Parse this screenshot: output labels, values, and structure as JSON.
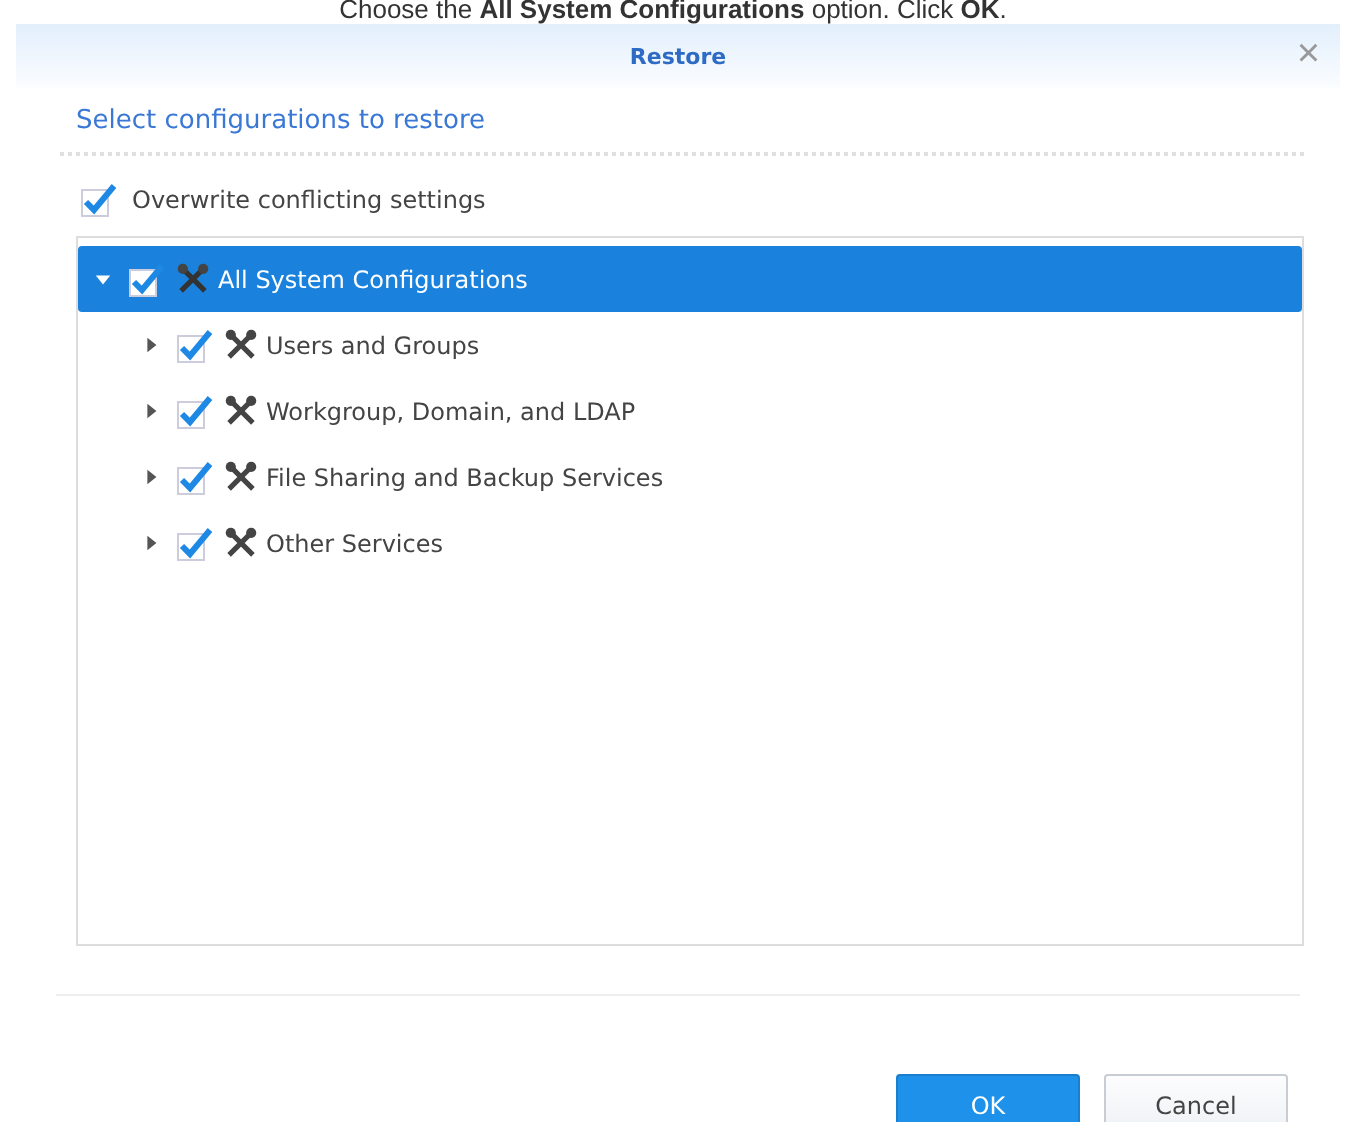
{
  "caption": "Choose the **All System Configurations** option. Click **OK**.",
  "window": {
    "title": "Restore",
    "close": "×"
  },
  "subtitle": "Select configurations to restore",
  "overwrite": {
    "label": "Overwrite conflicting settings",
    "checked": true
  },
  "tree": [
    {
      "label": "All System Configurations",
      "checked": true,
      "expanded": true,
      "selected": true,
      "children": [
        {
          "label": "Users and Groups",
          "checked": true,
          "expanded": false,
          "selected": false
        },
        {
          "label": "Workgroup, Domain, and LDAP",
          "checked": true,
          "expanded": false,
          "selected": false
        },
        {
          "label": "File Sharing and Backup Services",
          "checked": true,
          "expanded": false,
          "selected": false
        },
        {
          "label": "Other Services",
          "checked": true,
          "expanded": false,
          "selected": false
        }
      ]
    }
  ],
  "buttons": [
    {
      "label": "OK",
      "kind": "primary"
    },
    {
      "label": "Cancel",
      "kind": "secondary"
    }
  ]
}
